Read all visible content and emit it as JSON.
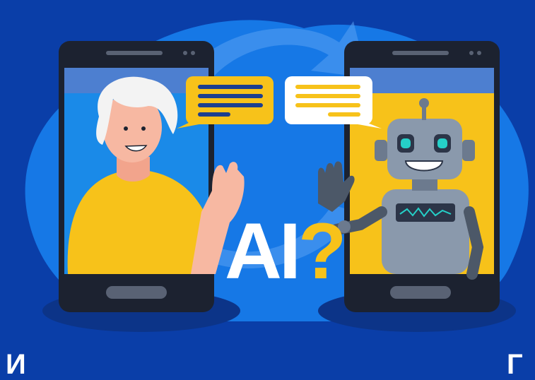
{
  "badge": {
    "text": "AI",
    "mark": "?"
  },
  "caption": {
    "left_fragment": "И",
    "right_fragment": "Г"
  },
  "icons": {
    "refresh": "refresh-arrows-icon",
    "left_bubble": "speech-bubble-icon",
    "right_bubble": "speech-bubble-icon",
    "robot_screen_wave": "waveform-icon"
  },
  "colors": {
    "background": "#0a3ea8",
    "blob": "#1678e6",
    "phone_body": "#1c2230",
    "accent_yellow": "#f7c21a",
    "human_screen": "#1a8ae8",
    "robot_screen": "#f7c21a"
  }
}
